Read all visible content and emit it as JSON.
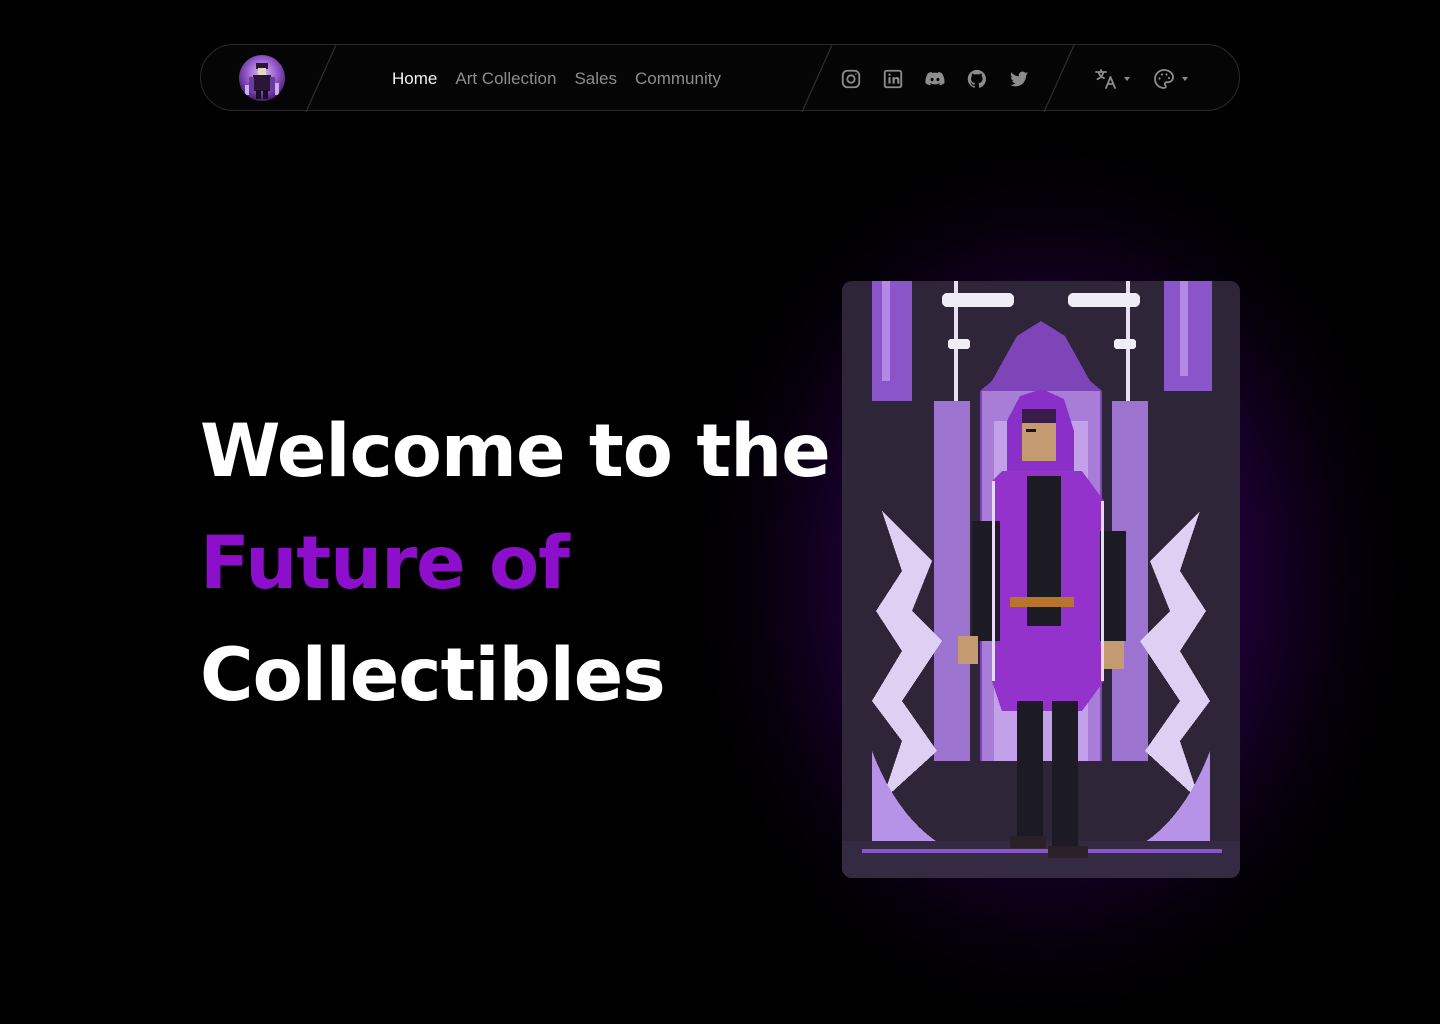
{
  "colors": {
    "background": "#000000",
    "accent": "#8d0fcc",
    "nav_text": "#8d8d8d",
    "nav_text_active": "#f2f2f2",
    "icon": "#8d8d8d",
    "glow": "#7d00d2"
  },
  "navbar": {
    "logo_icon": "avatar-logo-icon",
    "links": [
      {
        "label": "Home",
        "active": true
      },
      {
        "label": "Art Collection",
        "active": false
      },
      {
        "label": "Sales",
        "active": false
      },
      {
        "label": "Community",
        "active": false
      }
    ],
    "socials": [
      "instagram-icon",
      "linkedin-icon",
      "discord-icon",
      "github-icon",
      "twitter-icon"
    ],
    "controls": [
      "translate-icon",
      "palette-icon"
    ]
  },
  "hero": {
    "line1": "Welcome to the",
    "line2": "Future of",
    "line3": "Collectibles"
  },
  "artwork": {
    "icon": "pixel-art-hooded-figure-image"
  }
}
